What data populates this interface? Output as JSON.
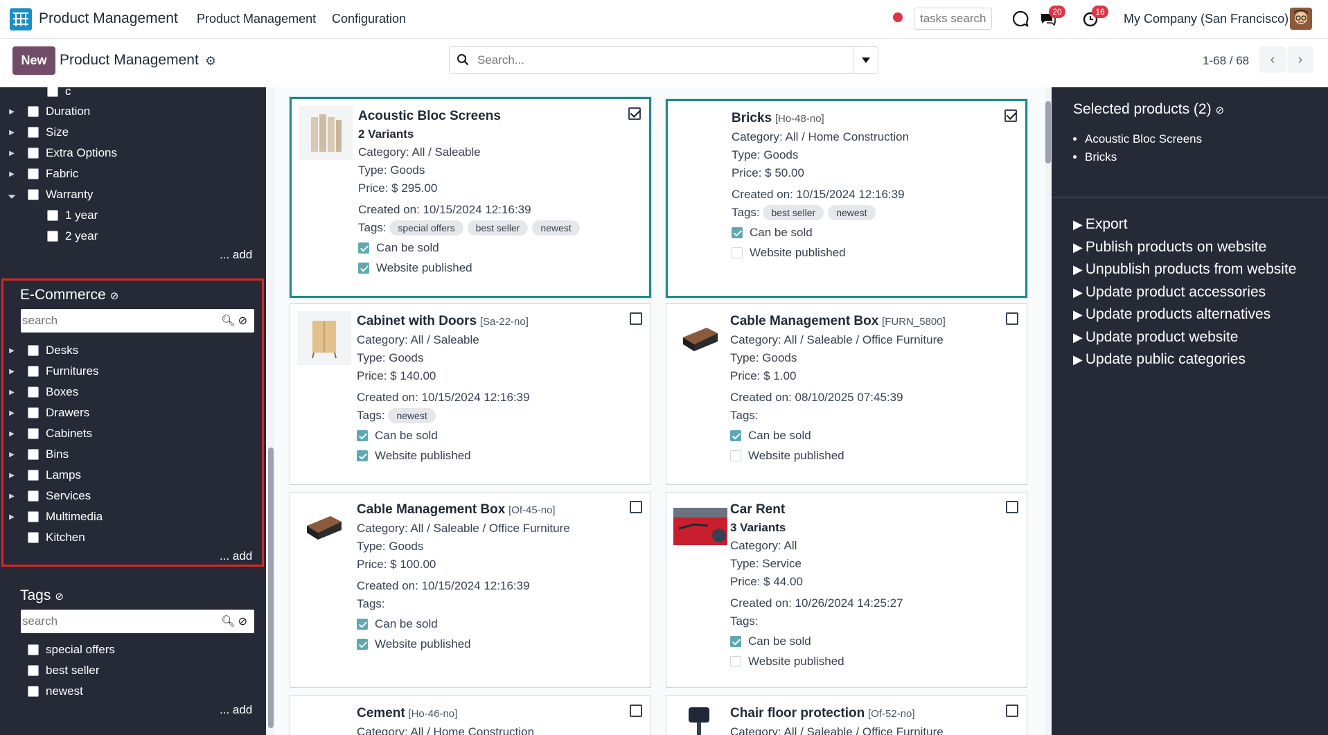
{
  "topbar": {
    "app_title": "Product Management",
    "nav": [
      "Product Management",
      "Configuration"
    ],
    "tasks_search_placeholder": "tasks search",
    "messages_count": "20",
    "activities_count": "16",
    "company": "My Company (San Francisco)"
  },
  "control": {
    "new_label": "New",
    "title": "Product Management",
    "search_placeholder": "Search...",
    "pager": "1-68 / 68"
  },
  "left_panel": {
    "top_items": [
      "c",
      "Duration",
      "Size",
      "Extra Options",
      "Fabric",
      "Warranty"
    ],
    "warranty_children": [
      "1 year",
      "2 year"
    ],
    "add_label": "... add",
    "ecommerce": {
      "title": "E-Commerce",
      "search_placeholder": "search",
      "items": [
        "Desks",
        "Furnitures",
        "Boxes",
        "Drawers",
        "Cabinets",
        "Bins",
        "Lamps",
        "Services",
        "Multimedia",
        "Kitchen"
      ],
      "add_label": "... add"
    },
    "tags": {
      "title": "Tags",
      "search_placeholder": "search",
      "items": [
        "special offers",
        "best seller",
        "newest"
      ],
      "add_label": "... add"
    }
  },
  "cards": [
    {
      "name": "Acoustic Bloc Screens",
      "ref": "",
      "variants": "2 Variants",
      "category": "Category: All / Saleable",
      "type": "Type: Goods",
      "price": "Price: $ 295.00",
      "created": "Created on: 10/15/2024 12:16:39",
      "tags_label": "Tags:",
      "tags": [
        "special offers",
        "best seller",
        "newest"
      ],
      "can_be_sold": "Can be sold",
      "website_published": "Website published"
    },
    {
      "name": "Bricks",
      "ref": "[Ho-48-no]",
      "variants": "",
      "category": "Category: All / Home Construction",
      "type": "Type: Goods",
      "price": "Price: $ 50.00",
      "created": "Created on: 10/15/2024 12:16:39",
      "tags_label": "Tags:",
      "tags": [
        "best seller",
        "newest"
      ],
      "can_be_sold": "Can be sold",
      "website_published": "Website published"
    },
    {
      "name": "Cabinet with Doors",
      "ref": "[Sa-22-no]",
      "variants": "",
      "category": "Category: All / Saleable",
      "type": "Type: Goods",
      "price": "Price: $ 140.00",
      "created": "Created on: 10/15/2024 12:16:39",
      "tags_label": "Tags:",
      "tags": [
        "newest"
      ],
      "can_be_sold": "Can be sold",
      "website_published": "Website published"
    },
    {
      "name": "Cable Management Box",
      "ref": "[FURN_5800]",
      "variants": "",
      "category": "Category: All / Saleable / Office Furniture",
      "type": "Type: Goods",
      "price": "Price: $ 1.00",
      "created": "Created on: 08/10/2025 07:45:39",
      "tags_label": "Tags:",
      "tags": [],
      "can_be_sold": "Can be sold",
      "website_published": "Website published"
    },
    {
      "name": "Cable Management Box",
      "ref": "[Of-45-no]",
      "variants": "",
      "category": "Category: All / Saleable / Office Furniture",
      "type": "Type: Goods",
      "price": "Price: $ 100.00",
      "created": "Created on: 10/15/2024 12:16:39",
      "tags_label": "Tags:",
      "tags": [],
      "can_be_sold": "Can be sold",
      "website_published": "Website published"
    },
    {
      "name": "Car Rent",
      "ref": "",
      "variants": "3 Variants",
      "category": "Category: All",
      "type": "Type: Service",
      "price": "Price: $ 44.00",
      "created": "Created on: 10/26/2024 14:25:27",
      "tags_label": "Tags:",
      "tags": [],
      "can_be_sold": "Can be sold",
      "website_published": "Website published"
    },
    {
      "name": "Cement",
      "ref": "[Ho-46-no]",
      "variants": "",
      "category": "Category: All / Home Construction"
    },
    {
      "name": "Chair floor protection",
      "ref": "[Of-52-no]",
      "variants": "",
      "category": "Category: All / Saleable / Office Furniture"
    }
  ],
  "right_panel": {
    "title": "Selected products (2)",
    "selected": [
      "Acoustic Bloc Screens",
      "Bricks"
    ],
    "actions": [
      "Export",
      "Publish products on website",
      "Unpublish products from website",
      "Update product accessories",
      "Update products alternatives",
      "Update product website",
      "Update public categories"
    ]
  }
}
